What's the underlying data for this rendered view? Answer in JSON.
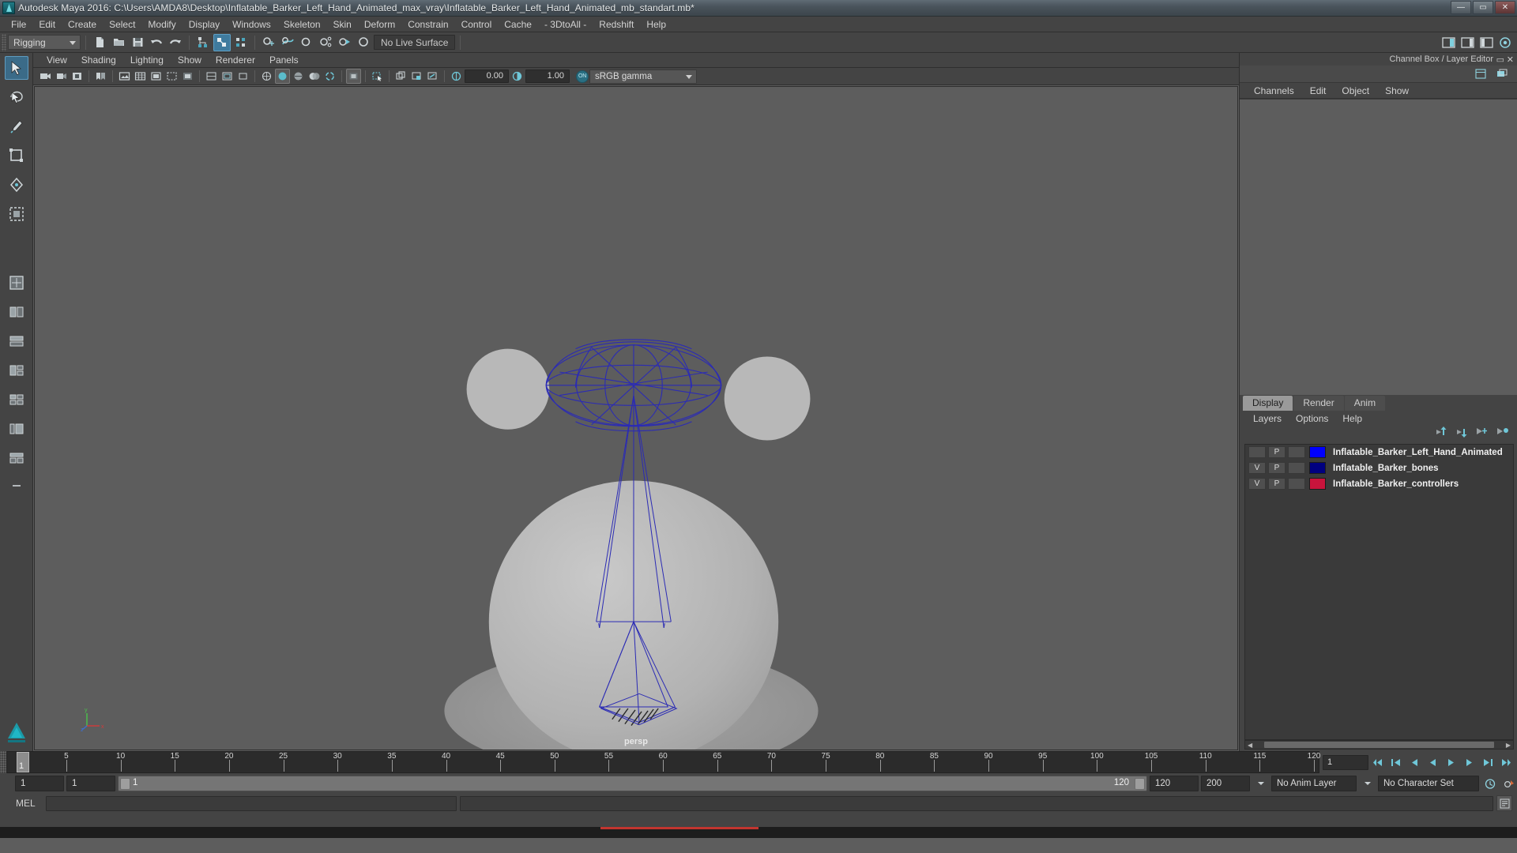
{
  "window": {
    "title": "Autodesk Maya 2016: C:\\Users\\AMDA8\\Desktop\\Inflatable_Barker_Left_Hand_Animated_max_vray\\Inflatable_Barker_Left_Hand_Animated_mb_standart.mb*",
    "minimize": "—",
    "maximize": "▭",
    "close": "✕"
  },
  "menubar": {
    "items": [
      {
        "label": "File"
      },
      {
        "label": "Edit"
      },
      {
        "label": "Create"
      },
      {
        "label": "Select"
      },
      {
        "label": "Modify"
      },
      {
        "label": "Display"
      },
      {
        "label": "Windows"
      },
      {
        "label": "Skeleton"
      },
      {
        "label": "Skin"
      },
      {
        "label": "Deform"
      },
      {
        "label": "Constrain"
      },
      {
        "label": "Control"
      },
      {
        "label": "Cache"
      },
      {
        "label": "- 3DtoAll -"
      },
      {
        "label": "Redshift"
      },
      {
        "label": "Help"
      }
    ]
  },
  "toolbar": {
    "menuset_value": "Rigging",
    "live_surface": "No Live Surface",
    "icons": [
      "new-scene-icon",
      "open-scene-icon",
      "save-scene-icon",
      "undo-icon",
      "redo-icon",
      "select-by-hierarchy-icon",
      "select-by-object-icon",
      "select-by-component-icon",
      "snap-to-grid-icon",
      "snap-to-curve-icon",
      "snap-to-point-icon",
      "snap-to-projected-center-icon",
      "snap-to-view-plane-icon",
      "make-live-icon"
    ],
    "right_icons": [
      "sidebar-toggle-icon",
      "attribute-editor-icon",
      "tool-settings-icon",
      "channel-box-icon"
    ]
  },
  "toolbox": {
    "tools": [
      {
        "name": "select-tool",
        "selected": true
      },
      {
        "name": "lasso-select-tool",
        "selected": false
      },
      {
        "name": "paint-select-tool",
        "selected": false
      },
      {
        "name": "move-tool",
        "selected": false
      },
      {
        "name": "rotate-tool",
        "selected": false
      },
      {
        "name": "scale-tool",
        "selected": false
      },
      {
        "name": "last-tool-used",
        "selected": false
      },
      {
        "name": "layout-single-pane",
        "selected": false
      },
      {
        "name": "layout-two-pane-split",
        "selected": false
      },
      {
        "name": "layout-two-stacked",
        "selected": false
      },
      {
        "name": "layout-three-pane",
        "selected": false
      },
      {
        "name": "layout-four-pane",
        "selected": false
      },
      {
        "name": "layout-persp-outliner",
        "selected": false
      },
      {
        "name": "layout-hypergraph",
        "selected": false
      },
      {
        "name": "layout-more",
        "selected": false
      }
    ]
  },
  "viewport": {
    "panel_menus": [
      {
        "label": "View"
      },
      {
        "label": "Shading"
      },
      {
        "label": "Lighting"
      },
      {
        "label": "Show"
      },
      {
        "label": "Renderer"
      },
      {
        "label": "Panels"
      }
    ],
    "camera_label": "persp",
    "exposure_value": "0.00",
    "gamma_value": "1.00",
    "color_management_toggle": "ON",
    "color_profile": "sRGB gamma",
    "toolbar_icons": [
      "select-camera-icon",
      "lock-camera-icon",
      "camera-attributes-icon",
      "bookmark-icon",
      "image-plane-icon",
      "two-d-pan-zoom-icon",
      "grid-toggle-icon",
      "film-gate-icon",
      "resolution-gate-icon",
      "gate-mask-icon",
      "field-chart-icon",
      "safe-action-icon",
      "safe-title-icon",
      "wireframe-icon",
      "smooth-shade-icon",
      "shaded-wireframe-icon",
      "textured-icon",
      "lights-icon",
      "shadows-icon",
      "screen-space-ao-icon",
      "motion-blur-icon",
      "multisample-aa-icon",
      "depth-of-field-icon",
      "isolate-select-icon",
      "xray-icon",
      "xray-joints-icon",
      "xray-active-icon",
      "exposure-icon",
      "gamma-icon"
    ],
    "axis_gizmo": {
      "x": "x",
      "y": "y",
      "z": "z"
    }
  },
  "channel_box": {
    "title": "Channel Box / Layer Editor",
    "menus": [
      {
        "label": "Channels"
      },
      {
        "label": "Edit"
      },
      {
        "label": "Object"
      },
      {
        "label": "Show"
      }
    ],
    "tool_icons": [
      "channel-box-display-icon",
      "layer-editor-icon"
    ]
  },
  "layer_editor": {
    "tabs": [
      {
        "label": "Display",
        "selected": true
      },
      {
        "label": "Render",
        "selected": false
      },
      {
        "label": "Anim",
        "selected": false
      }
    ],
    "menus": [
      {
        "label": "Layers"
      },
      {
        "label": "Options"
      },
      {
        "label": "Help"
      }
    ],
    "buttons": [
      "move-layer-up-icon",
      "move-layer-down-icon",
      "new-layer-icon",
      "new-layer-from-selected-icon"
    ],
    "columns": [
      "visibility",
      "playback",
      "reference",
      "color",
      "name"
    ],
    "layers": [
      {
        "visibility": "",
        "playback": "P",
        "reference": "",
        "color": "#0000ff",
        "name": "Inflatable_Barker_Left_Hand_Animated"
      },
      {
        "visibility": "V",
        "playback": "P",
        "reference": "",
        "color": "#000080",
        "name": "Inflatable_Barker_bones"
      },
      {
        "visibility": "V",
        "playback": "P",
        "reference": "",
        "color": "#c8143c",
        "name": "Inflatable_Barker_controllers"
      }
    ]
  },
  "timeline": {
    "current_frame": "1",
    "tick_labels": [
      "5",
      "10",
      "15",
      "20",
      "25",
      "30",
      "35",
      "40",
      "45",
      "50",
      "55",
      "60",
      "65",
      "70",
      "75",
      "80",
      "85",
      "90",
      "95",
      "100",
      "105",
      "110",
      "115",
      "120"
    ],
    "frame_field": "1",
    "playback_buttons": [
      "go-to-start-icon",
      "step-back-keyframe-icon",
      "step-back-frame-icon",
      "play-backwards-icon",
      "play-forwards-icon",
      "step-forward-frame-icon",
      "step-forward-keyframe-icon",
      "go-to-end-icon"
    ]
  },
  "range": {
    "anim_start": "1",
    "playback_start": "1",
    "slider_min_label": "1",
    "slider_max_label": "120",
    "playback_end": "120",
    "anim_end": "200",
    "anim_layer": "No Anim Layer",
    "character_set": "No Character Set",
    "right_icons": [
      "auto-key-icon",
      "animation-preferences-icon"
    ]
  },
  "command_line": {
    "language_label": "MEL",
    "input_value": "",
    "output_value": "",
    "script_editor_icon": "script-editor-icon"
  }
}
